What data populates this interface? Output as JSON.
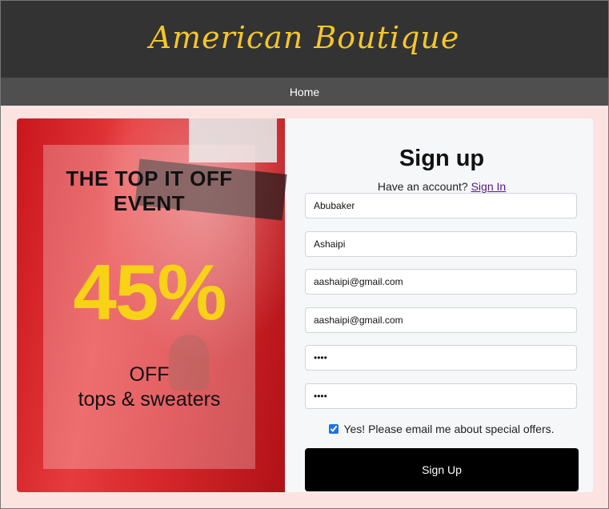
{
  "header": {
    "brand": "American Boutique"
  },
  "nav": {
    "home": "Home"
  },
  "promo": {
    "headline_line1": "THE TOP IT OFF",
    "headline_line2": "EVENT",
    "percent": "45%",
    "off": "OFF",
    "sub": "tops & sweaters"
  },
  "signup": {
    "title": "Sign up",
    "have_account": "Have an account? ",
    "signin_link": "Sign In",
    "first_name": "Abubaker",
    "last_name": "Ashaipi",
    "email": "aashaipi@gmail.com",
    "confirm_email": "aashaipi@gmail.com",
    "password": "abcd",
    "confirm_password": "abcd",
    "offers_label": "Yes! Please email me about special offers.",
    "submit_label": "Sign Up"
  },
  "colors": {
    "header_bg": "#333333",
    "brand": "#f4c62a",
    "nav_bg": "#4f4f4f",
    "page_bg": "#fbe3e1",
    "promo_red": "#d8282c",
    "percent": "#f7d216",
    "button_bg": "#000000"
  }
}
